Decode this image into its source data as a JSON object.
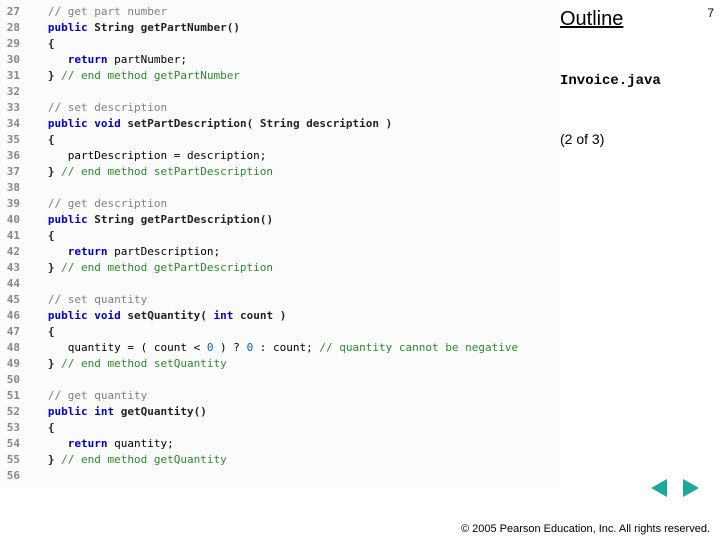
{
  "page_number": "7",
  "outline_label": "Outline",
  "filename": "Invoice.java",
  "page_of": "(2 of 3)",
  "copyright": "© 2005 Pearson Education, Inc.  All rights reserved.",
  "code": [
    {
      "n": "27",
      "tokens": [
        [
          "   ",
          ""
        ],
        [
          "// get part number",
          "c"
        ]
      ]
    },
    {
      "n": "28",
      "tokens": [
        [
          "   ",
          ""
        ],
        [
          "public",
          "k"
        ],
        [
          " ",
          ""
        ],
        [
          "String",
          "id"
        ],
        [
          " ",
          ""
        ],
        [
          "getPartNumber()",
          "id"
        ]
      ]
    },
    {
      "n": "29",
      "tokens": [
        [
          "   ",
          ""
        ],
        [
          "{",
          "id"
        ]
      ]
    },
    {
      "n": "30",
      "tokens": [
        [
          "      ",
          ""
        ],
        [
          "return",
          "k"
        ],
        [
          " partNumber;",
          ""
        ]
      ]
    },
    {
      "n": "31",
      "tokens": [
        [
          "   ",
          ""
        ],
        [
          "}",
          "id"
        ],
        [
          " ",
          ""
        ],
        [
          "// end method getPartNumber",
          "ce"
        ]
      ]
    },
    {
      "n": "32",
      "tokens": []
    },
    {
      "n": "33",
      "tokens": [
        [
          "   ",
          ""
        ],
        [
          "// set description",
          "c"
        ]
      ]
    },
    {
      "n": "34",
      "tokens": [
        [
          "   ",
          ""
        ],
        [
          "public",
          "k"
        ],
        [
          " ",
          ""
        ],
        [
          "void",
          "t"
        ],
        [
          " ",
          ""
        ],
        [
          "setPartDescription( String description )",
          "id"
        ]
      ]
    },
    {
      "n": "35",
      "tokens": [
        [
          "   ",
          ""
        ],
        [
          "{",
          "id"
        ]
      ]
    },
    {
      "n": "36",
      "tokens": [
        [
          "      partDescription = description;",
          ""
        ]
      ]
    },
    {
      "n": "37",
      "tokens": [
        [
          "   ",
          ""
        ],
        [
          "}",
          "id"
        ],
        [
          " ",
          ""
        ],
        [
          "// end method setPartDescription",
          "ce"
        ]
      ]
    },
    {
      "n": "38",
      "tokens": []
    },
    {
      "n": "39",
      "tokens": [
        [
          "   ",
          ""
        ],
        [
          "// get description",
          "c"
        ]
      ]
    },
    {
      "n": "40",
      "tokens": [
        [
          "   ",
          ""
        ],
        [
          "public",
          "k"
        ],
        [
          " ",
          ""
        ],
        [
          "String",
          "id"
        ],
        [
          " ",
          ""
        ],
        [
          "getPartDescription()",
          "id"
        ]
      ]
    },
    {
      "n": "41",
      "tokens": [
        [
          "   ",
          ""
        ],
        [
          "{",
          "id"
        ]
      ]
    },
    {
      "n": "42",
      "tokens": [
        [
          "      ",
          ""
        ],
        [
          "return",
          "k"
        ],
        [
          " partDescription;",
          ""
        ]
      ]
    },
    {
      "n": "43",
      "tokens": [
        [
          "   ",
          ""
        ],
        [
          "}",
          "id"
        ],
        [
          " ",
          ""
        ],
        [
          "// end method getPartDescription",
          "ce"
        ]
      ]
    },
    {
      "n": "44",
      "tokens": []
    },
    {
      "n": "45",
      "tokens": [
        [
          "   ",
          ""
        ],
        [
          "// set quantity",
          "c"
        ]
      ]
    },
    {
      "n": "46",
      "tokens": [
        [
          "   ",
          ""
        ],
        [
          "public",
          "k"
        ],
        [
          " ",
          ""
        ],
        [
          "void",
          "t"
        ],
        [
          " ",
          ""
        ],
        [
          "setQuantity( ",
          "id"
        ],
        [
          "int",
          "t"
        ],
        [
          " count )",
          "id"
        ]
      ]
    },
    {
      "n": "47",
      "tokens": [
        [
          "   ",
          ""
        ],
        [
          "{",
          "id"
        ]
      ]
    },
    {
      "n": "48",
      "tokens": [
        [
          "      quantity = ( count < ",
          ""
        ],
        [
          "0",
          "n"
        ],
        [
          " ) ? ",
          ""
        ],
        [
          "0",
          "n"
        ],
        [
          " : count; ",
          ""
        ],
        [
          "// quantity cannot be negative",
          "ce"
        ]
      ]
    },
    {
      "n": "49",
      "tokens": [
        [
          "   ",
          ""
        ],
        [
          "}",
          "id"
        ],
        [
          " ",
          ""
        ],
        [
          "// end method setQuantity",
          "ce"
        ]
      ]
    },
    {
      "n": "50",
      "tokens": []
    },
    {
      "n": "51",
      "tokens": [
        [
          "   ",
          ""
        ],
        [
          "// get quantity",
          "c"
        ]
      ]
    },
    {
      "n": "52",
      "tokens": [
        [
          "   ",
          ""
        ],
        [
          "public",
          "k"
        ],
        [
          " ",
          ""
        ],
        [
          "int",
          "t"
        ],
        [
          " ",
          ""
        ],
        [
          "getQuantity()",
          "id"
        ]
      ]
    },
    {
      "n": "53",
      "tokens": [
        [
          "   ",
          ""
        ],
        [
          "{",
          "id"
        ]
      ]
    },
    {
      "n": "54",
      "tokens": [
        [
          "      ",
          ""
        ],
        [
          "return",
          "k"
        ],
        [
          " quantity;",
          ""
        ]
      ]
    },
    {
      "n": "55",
      "tokens": [
        [
          "   ",
          ""
        ],
        [
          "}",
          "id"
        ],
        [
          " ",
          ""
        ],
        [
          "// end method getQuantity",
          "ce"
        ]
      ]
    },
    {
      "n": "56",
      "tokens": []
    }
  ]
}
